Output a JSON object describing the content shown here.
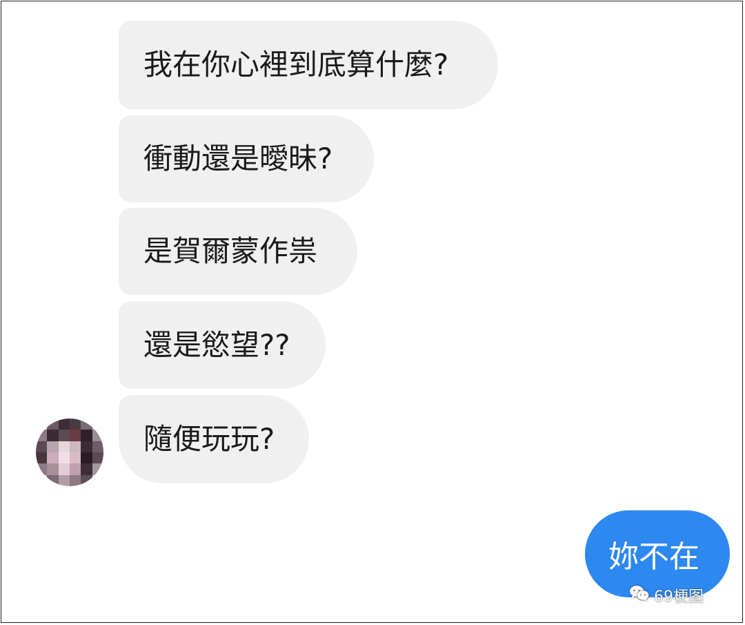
{
  "conversation": {
    "incoming_messages": [
      "我在你心裡到底算什麼?",
      "衝動還是曖昧?",
      "是賀爾蒙作祟",
      "還是慾望??",
      "隨便玩玩?"
    ],
    "outgoing_messages": [
      "妳不在"
    ]
  },
  "watermark": {
    "text": "69梗图",
    "icon": "wechat-icon"
  },
  "colors": {
    "incoming_bubble": "#f0f0f0",
    "outgoing_bubble": "#2d88f0",
    "text_dark": "#1a1a1a",
    "text_light": "#ffffff"
  }
}
